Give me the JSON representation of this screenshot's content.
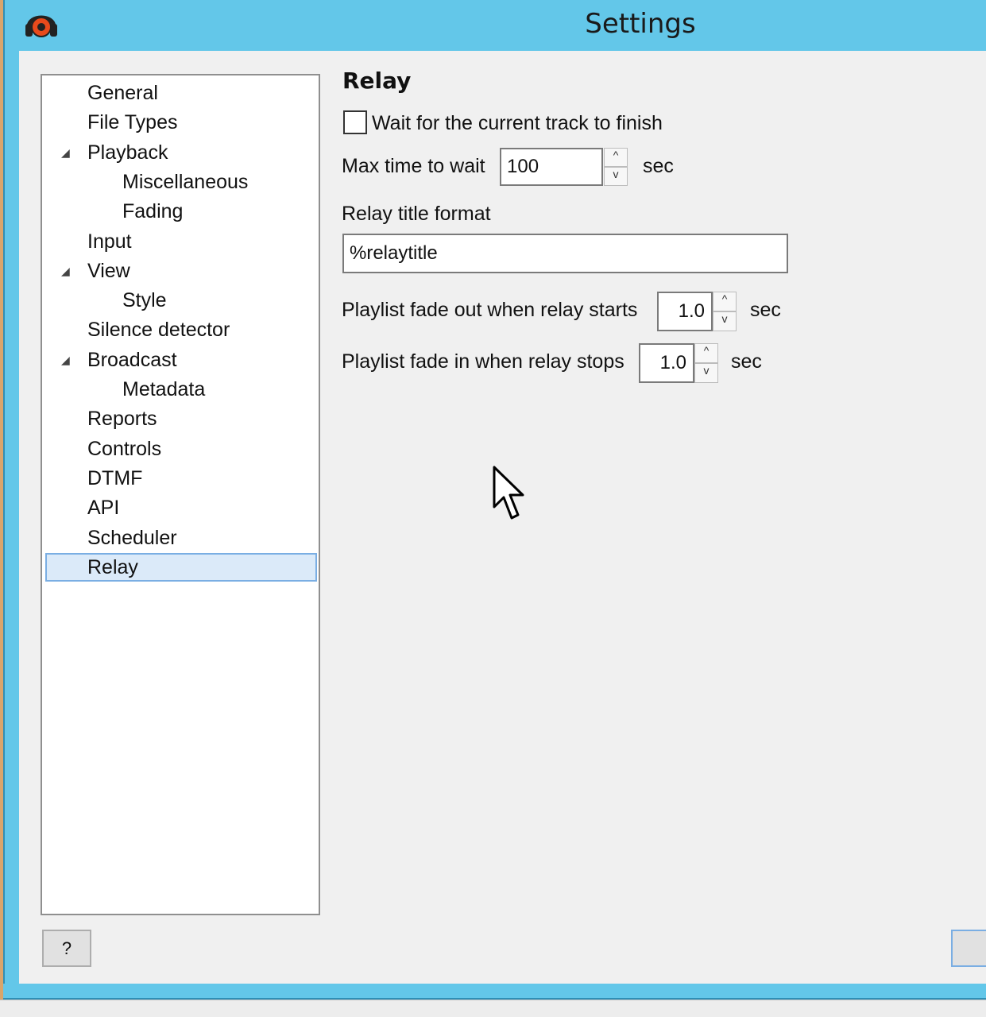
{
  "window": {
    "title": "Settings",
    "app_icon": "headphones-app-icon"
  },
  "tree": {
    "items": [
      {
        "label": "General",
        "level": 0,
        "expanded": null
      },
      {
        "label": "File Types",
        "level": 0,
        "expanded": null
      },
      {
        "label": "Playback",
        "level": 0,
        "expanded": true
      },
      {
        "label": "Miscellaneous",
        "level": 1,
        "expanded": null
      },
      {
        "label": "Fading",
        "level": 1,
        "expanded": null
      },
      {
        "label": "Input",
        "level": 0,
        "expanded": null
      },
      {
        "label": "View",
        "level": 0,
        "expanded": true
      },
      {
        "label": "Style",
        "level": 1,
        "expanded": null
      },
      {
        "label": "Silence detector",
        "level": 0,
        "expanded": null
      },
      {
        "label": "Broadcast",
        "level": 0,
        "expanded": true
      },
      {
        "label": "Metadata",
        "level": 1,
        "expanded": null
      },
      {
        "label": "Reports",
        "level": 0,
        "expanded": null
      },
      {
        "label": "Controls",
        "level": 0,
        "expanded": null
      },
      {
        "label": "DTMF",
        "level": 0,
        "expanded": null
      },
      {
        "label": "API",
        "level": 0,
        "expanded": null
      },
      {
        "label": "Scheduler",
        "level": 0,
        "expanded": null
      },
      {
        "label": "Relay",
        "level": 0,
        "expanded": null,
        "selected": true
      }
    ],
    "expander_glyph": "◢"
  },
  "relay": {
    "title": "Relay",
    "wait_checkbox_label": "Wait for the current track to finish",
    "wait_checked": false,
    "max_wait_label": "Max time to wait",
    "max_wait_value": "100",
    "max_wait_unit": "sec",
    "title_format_label": "Relay title format",
    "title_format_value": "%relaytitle",
    "fade_out_label": "Playlist fade out when relay starts",
    "fade_out_value": "1.0",
    "fade_out_unit": "sec",
    "fade_in_label": "Playlist fade in when relay stops",
    "fade_in_value": "1.0",
    "fade_in_unit": "sec"
  },
  "buttons": {
    "help_label": "?"
  },
  "spin_glyphs": {
    "up": "^",
    "down": "v"
  },
  "colors": {
    "titlebar": "#63c7e9",
    "selection_fill": "#dbeaf9",
    "selection_border": "#7aaee3"
  }
}
